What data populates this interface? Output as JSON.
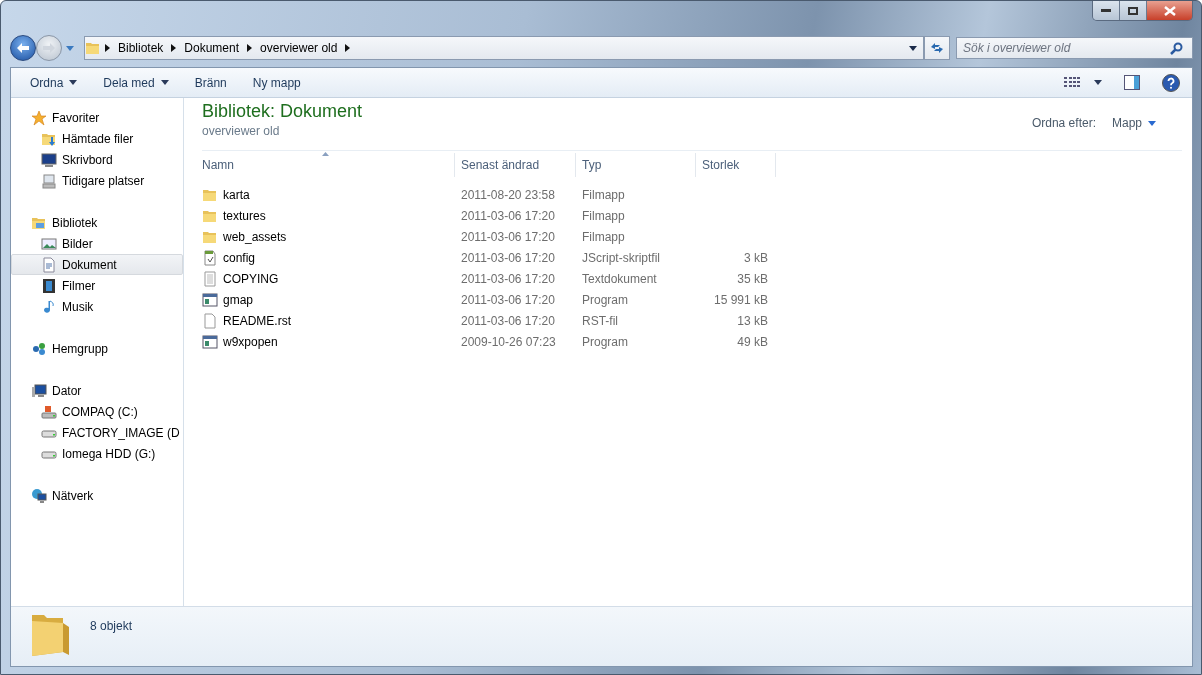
{
  "address": {
    "breadcrumbs": [
      "Bibliotek",
      "Dokument",
      "overviewer old"
    ]
  },
  "search": {
    "placeholder": "Sök i overviewer old"
  },
  "toolbar": {
    "buttons": [
      {
        "label": "Ordna",
        "dropdown": true
      },
      {
        "label": "Dela med",
        "dropdown": true
      },
      {
        "label": "Bränn",
        "dropdown": false
      },
      {
        "label": "Ny mapp",
        "dropdown": false
      }
    ]
  },
  "sidebar": {
    "groups": [
      {
        "label": "Favoriter",
        "kind": "star",
        "selected": false,
        "children": [
          {
            "label": "Hämtade filer",
            "kind": "download",
            "selected": false
          },
          {
            "label": "Skrivbord",
            "kind": "desktop",
            "selected": false
          },
          {
            "label": "Tidigare platser",
            "kind": "recent",
            "selected": false
          }
        ]
      },
      {
        "label": "Bibliotek",
        "kind": "library",
        "selected": false,
        "children": [
          {
            "label": "Bilder",
            "kind": "pictures",
            "selected": false
          },
          {
            "label": "Dokument",
            "kind": "document",
            "selected": true
          },
          {
            "label": "Filmer",
            "kind": "film",
            "selected": false
          },
          {
            "label": "Musik",
            "kind": "music",
            "selected": false
          }
        ]
      },
      {
        "label": "Hemgrupp",
        "kind": "homegroup",
        "selected": false
      },
      {
        "label": "Dator",
        "kind": "computer",
        "selected": false,
        "children": [
          {
            "label": "COMPAQ (C:)",
            "kind": "osdrive",
            "selected": false
          },
          {
            "label": "FACTORY_IMAGE (D",
            "kind": "drive",
            "selected": false
          },
          {
            "label": "Iomega HDD (G:)",
            "kind": "drive",
            "selected": false
          }
        ]
      },
      {
        "label": "Nätverk",
        "kind": "network",
        "selected": false
      }
    ]
  },
  "library": {
    "title": "Bibliotek: Dokument",
    "subtitle": "overviewer old",
    "arrange_label": "Ordna efter:",
    "arrange_value": "Mapp"
  },
  "table": {
    "columns": [
      {
        "label": "Namn",
        "sorted": true
      },
      {
        "label": "Senast ändrad",
        "sorted": false
      },
      {
        "label": "Typ",
        "sorted": false
      },
      {
        "label": "Storlek",
        "sorted": false
      }
    ],
    "rows": [
      {
        "kind": "folder",
        "name": "karta",
        "modified": "2011-08-20 23:58",
        "type": "Filmapp"
      },
      {
        "kind": "folder",
        "name": "textures",
        "modified": "2011-03-06 17:20",
        "type": "Filmapp"
      },
      {
        "kind": "folder",
        "name": "web_assets",
        "modified": "2011-03-06 17:20",
        "type": "Filmapp"
      },
      {
        "kind": "script",
        "name": "config",
        "modified": "2011-03-06 17:20",
        "type": "JScript-skriptfil",
        "size": "3 kB"
      },
      {
        "kind": "text",
        "name": "COPYING",
        "modified": "2011-03-06 17:20",
        "type": "Textdokument",
        "size": "35 kB"
      },
      {
        "kind": "program",
        "name": "gmap",
        "modified": "2011-03-06 17:20",
        "type": "Program",
        "size": "15 991 kB"
      },
      {
        "kind": "file",
        "name": "README.rst",
        "modified": "2011-03-06 17:20",
        "type": "RST-fil",
        "size": "13 kB"
      },
      {
        "kind": "program",
        "name": "w9xpopen",
        "modified": "2009-10-26 07:23",
        "type": "Program",
        "size": "49 kB"
      }
    ]
  },
  "status_bar": {
    "count": "8 objekt"
  }
}
